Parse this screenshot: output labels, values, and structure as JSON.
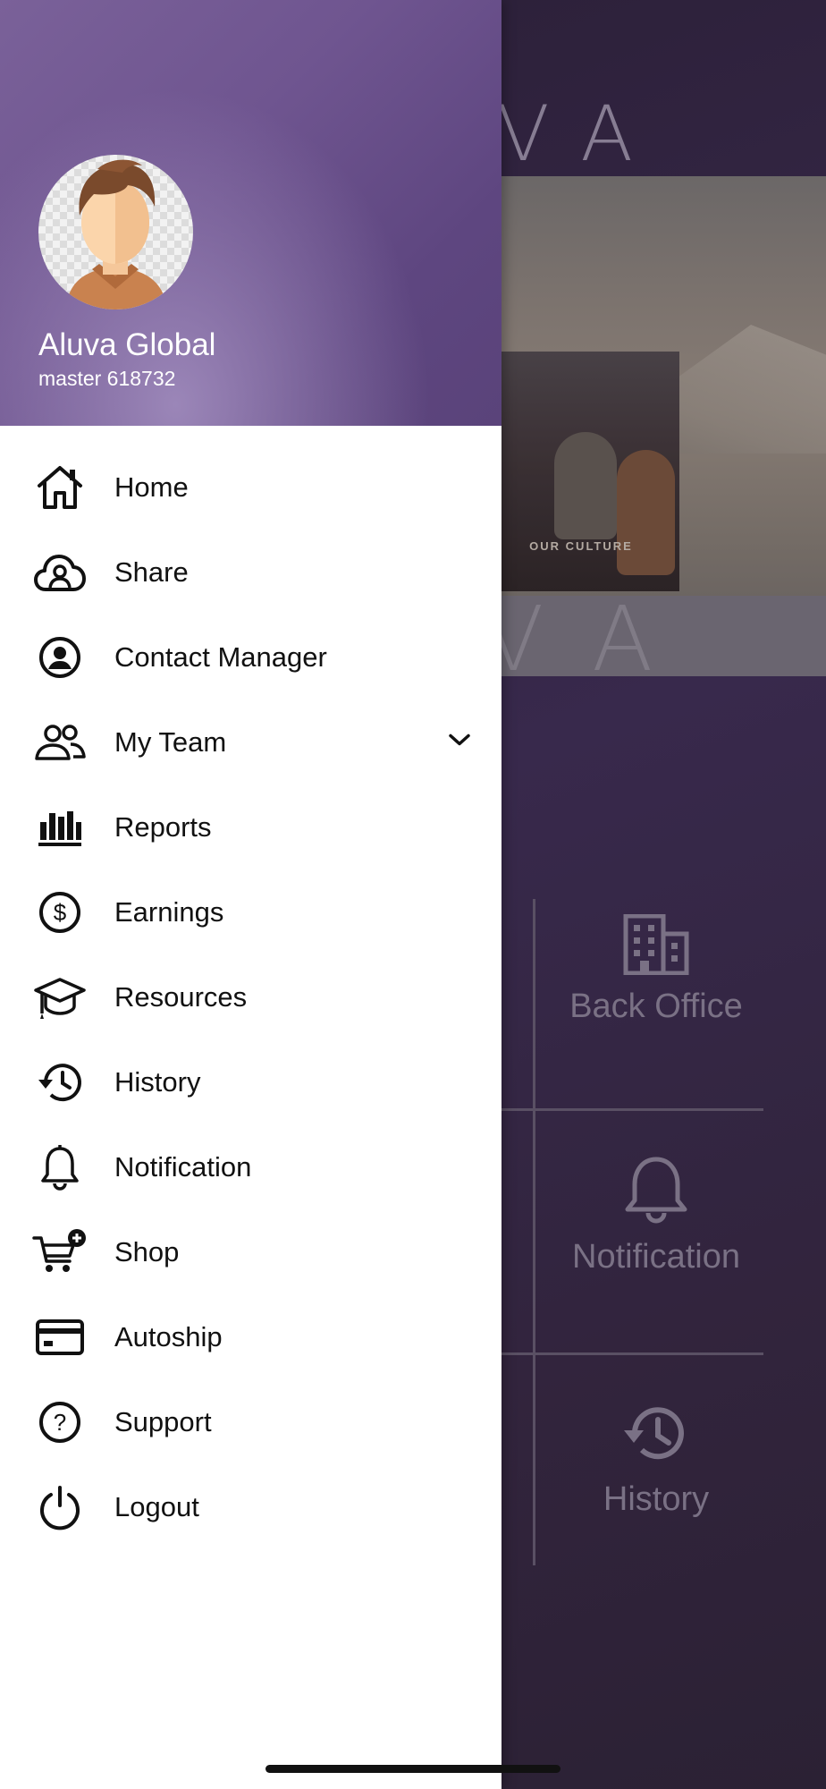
{
  "background_app": {
    "logo_top": "VA",
    "culture_label": "OUR CULTURE",
    "logo_bottom": "VA",
    "tiles": [
      {
        "label": "Back Office",
        "icon": "building-icon"
      },
      {
        "label": "Notification",
        "icon": "bell-icon"
      },
      {
        "label": "History",
        "icon": "history-icon"
      }
    ]
  },
  "drawer": {
    "profile": {
      "name": "Aluva Global",
      "subtitle": "master 618732"
    },
    "menu": [
      {
        "label": "Home",
        "icon": "home-icon"
      },
      {
        "label": "Share",
        "icon": "share-icon"
      },
      {
        "label": "Contact Manager",
        "icon": "contact-manager-icon"
      },
      {
        "label": "My Team",
        "icon": "team-icon",
        "expandable": true
      },
      {
        "label": "Reports",
        "icon": "reports-icon"
      },
      {
        "label": "Earnings",
        "icon": "earnings-icon"
      },
      {
        "label": "Resources",
        "icon": "resources-icon"
      },
      {
        "label": "History",
        "icon": "history-icon"
      },
      {
        "label": "Notification",
        "icon": "notification-icon"
      },
      {
        "label": "Shop",
        "icon": "shop-icon"
      },
      {
        "label": "Autoship",
        "icon": "autoship-icon"
      },
      {
        "label": "Support",
        "icon": "support-icon"
      },
      {
        "label": "Logout",
        "icon": "logout-icon"
      }
    ]
  },
  "colors": {
    "header_purple": "#6f5590",
    "drawer_bg": "#ffffff",
    "text": "#111111",
    "app_bg": "#2b2038"
  }
}
